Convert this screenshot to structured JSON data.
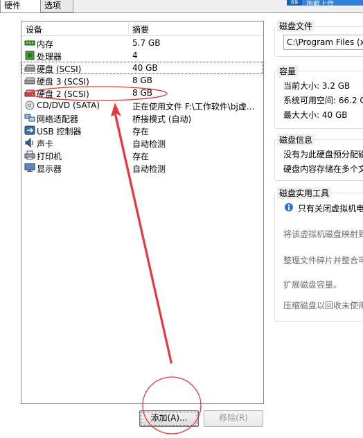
{
  "tabs": [
    {
      "label": "硬件"
    },
    {
      "label": "选项"
    }
  ],
  "top_badge": {
    "glyph": "69",
    "text": "抱歉上传"
  },
  "device_list": {
    "col_device": "设备",
    "col_summary": "摘要",
    "rows": [
      {
        "name": "内存",
        "summary": "5.7 GB",
        "icon": "memory-icon"
      },
      {
        "name": "处理器",
        "summary": "4",
        "icon": "processor-icon"
      },
      {
        "name": "硬盘 (SCSI)",
        "summary": "40 GB",
        "icon": "hard-disk-icon"
      },
      {
        "name": "硬盘 3 (SCSI)",
        "summary": "8 GB",
        "icon": "hard-disk-icon"
      },
      {
        "name": "硬盘 2 (SCSI)",
        "summary": "8 GB",
        "icon": "hard-disk-red-icon"
      },
      {
        "name": "CD/DVD (SATA)",
        "summary": "正在使用文件 F:\\工作软件\\bj虚...",
        "icon": "cd-dvd-icon"
      },
      {
        "name": "网络适配器",
        "summary": "桥接模式 (自动)",
        "icon": "network-adapter-icon"
      },
      {
        "name": "USB 控制器",
        "summary": "存在",
        "icon": "usb-icon"
      },
      {
        "name": "声卡",
        "summary": "自动检测",
        "icon": "sound-card-icon"
      },
      {
        "name": "打印机",
        "summary": "存在",
        "icon": "printer-icon"
      },
      {
        "name": "显示器",
        "summary": "自动检测",
        "icon": "display-icon"
      }
    ]
  },
  "buttons": {
    "add": "添加(A)...",
    "remove": "移除(R)"
  },
  "disk_file": {
    "title": "磁盘文件",
    "path": "C:\\Program Files (x86"
  },
  "capacity": {
    "title": "容量",
    "current": "当前大小: 3.2 GB",
    "available": "系统可用空间: 66.2 G",
    "max": "最大大小: 40 GB"
  },
  "disk_info": {
    "title": "磁盘信息",
    "line1": "没有为此硬盘预分配磁",
    "line2": "硬盘内容存储在多个文"
  },
  "disk_utilities": {
    "title": "磁盘实用工具",
    "notice": "只有关闭虚拟机电",
    "map": "将该虚拟机磁盘映射到",
    "defrag": "整理文件碎片并整合可",
    "expand": "扩展磁盘容量。",
    "compact": "压缩磁盘以回收未使用"
  },
  "colors": {
    "annotation": "#e8383c",
    "tab_blue": "#2f80d8"
  }
}
